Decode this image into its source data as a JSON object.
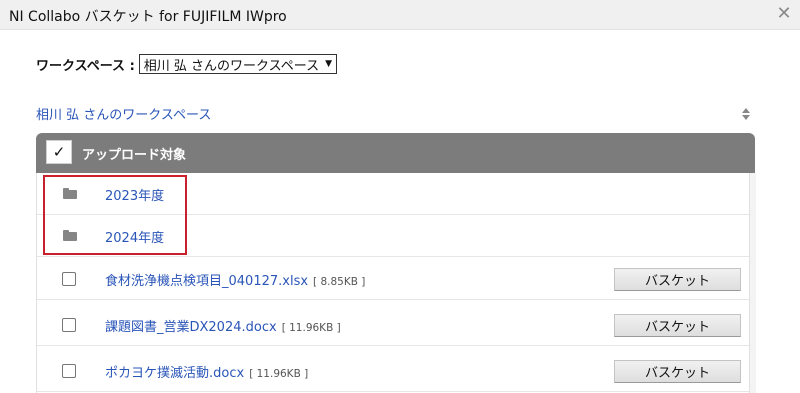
{
  "window": {
    "title": "NI Collabo バスケット for FUJIFILM IWpro",
    "close_symbol": "✕"
  },
  "workspace": {
    "label": "ワークスペース :",
    "selected": "相川 弘 さんのワークスペース"
  },
  "breadcrumb": "相川 弘 さんのワークスペース",
  "list": {
    "header": {
      "check_symbol": "✓",
      "label": "アップロード対象"
    },
    "folders": [
      {
        "name": "2023年度",
        "icon": "folder-icon"
      },
      {
        "name": "2024年度",
        "icon": "folder-icon"
      }
    ],
    "files": [
      {
        "name": "食材洗浄機点検項目_040127.xlsx",
        "size": "[ 8.85KB ]",
        "button": "バスケット"
      },
      {
        "name": "課題図書_営業DX2024.docx",
        "size": "[ 11.96KB ]",
        "button": "バスケット"
      },
      {
        "name": "ポカヨケ撲滅活動.docx",
        "size": "[ 11.96KB ]",
        "button": "バスケット"
      }
    ]
  },
  "colors": {
    "link": "#2a55b8",
    "header_bg": "#7c7c7c",
    "highlight": "#c8202c"
  }
}
